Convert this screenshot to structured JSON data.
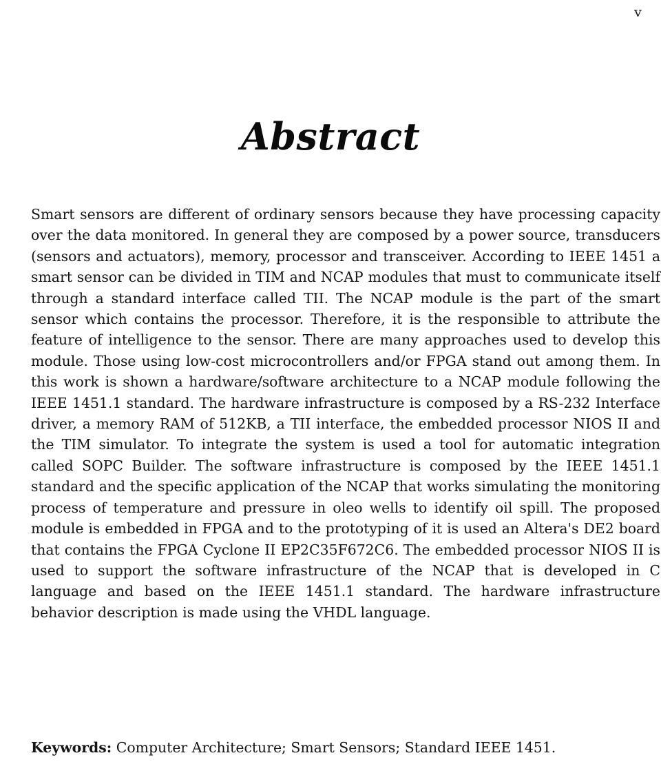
{
  "document": {
    "type": "thesis-abstract-page",
    "folio": "v",
    "title": "Abstract",
    "abstract_text": "Smart sensors are different of ordinary sensors because they have processing capacity over the data monitored. In general they are composed by a power source, transducers (sensors and actuators), memory, processor and transceiver. According to IEEE 1451 a smart sensor can be divided in TIM and NCAP modules that must to communicate itself through a standard interface called TII. The NCAP module is the part of the smart sensor which contains the processor. Therefore, it is the responsible to attribute the feature of intelligence to the sensor. There are many approaches used to develop this module. Those using low-cost microcontrollers and/or FPGA stand out among them. In this work is shown a hardware/software architecture to a NCAP module following the IEEE 1451.1 standard. The hardware infrastructure is composed by a RS-232 Interface driver, a memory RAM of 512KB, a TII interface, the embedded processor NIOS II and the TIM simulator. To integrate the system is used a tool for automatic integration called SOPC Builder. The software infrastructure is composed by the IEEE 1451.1 standard and the specific application of the NCAP that works simulating the monitoring process of temperature and pressure in oleo wells to identify oil spill. The proposed module is embedded in FPGA and to the prototyping of it is used an Altera's DE2 board that contains the FPGA Cyclone II EP2C35F672C6. The embedded processor NIOS II is used to support the software infrastructure of the NCAP that is developed in C language and based on the IEEE 1451.1 standard. The hardware infrastructure behavior description is made using the VHDL language.",
    "abstract_lines": [
      "Smart sensors are different of ordinary sensors because they have processing capacity",
      "over the data monitored.  In general they are composed by a power source, transducers",
      "(sensors and actuators), memory, processor and transceiver.  According to IEEE 1451",
      "a smart sensor can be divided in TIM and NCAP modules that must to communicate",
      "itself through a standard interface called TII. The NCAP module is the part of the smart",
      "sensor which contains the processor.  Therefore, it is the responsible to attribute the",
      "feature of intelligence to the sensor.  There are many approaches used to develop this",
      "module.  Those using low-cost microcontrollers and/or FPGA stand out among them.  In",
      "this work is shown a hardware/software architecture to a NCAP module following the",
      "IEEE 1451.1 standard.  The hardware infrastructure is composed by a RS-232 Interface",
      "driver, a memory RAM of 512KB, a TII interface, the embedded processor NIOS II and",
      "the TIM simulator.  To integrate the system is used a tool for automatic integration called",
      "SOPC Builder.  The software infrastructure is composed by the IEEE 1451.1 standard",
      "and the specific application of the NCAP that works simulating the monitoring process",
      "of temperature and pressure in oleo wells to identify oil spill.  The proposed module is",
      "embedded in FPGA and to the prototyping of it is used an Altera's DE2 board that",
      "contains the FPGA Cyclone II EP2C35F672C6. The embedded processor NIOS II is used",
      "to support the software infrastructure of the NCAP that is developed in C language and",
      "based on the IEEE 1451.1 standard.  The hardware infrastructure behavior description is",
      "made using the VHDL language."
    ],
    "keywords": {
      "label": "Keywords:",
      "value": "Computer Architecture; Smart Sensors; Standard IEEE 1451."
    }
  }
}
